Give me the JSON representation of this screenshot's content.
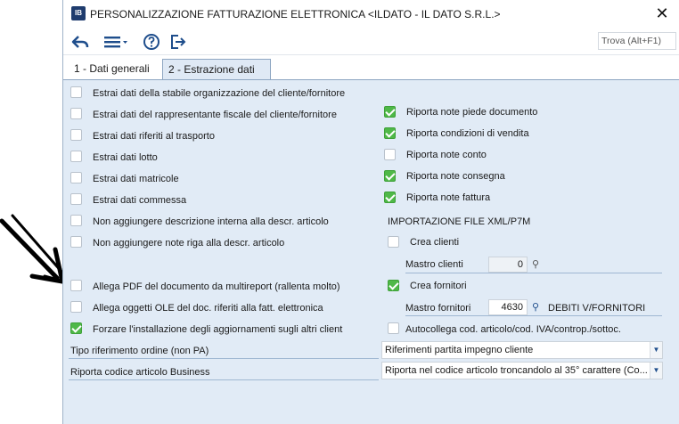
{
  "window": {
    "title": "PERSONALIZZAZIONE FATTURAZIONE ELETTRONICA <ILDATO - IL DATO S.R.L.>",
    "app_icon_text": "IB",
    "close_glyph": "✕"
  },
  "toolbar": {
    "search_placeholder": "Trova (Alt+F1)",
    "icons": [
      "back-arrow-icon",
      "menu-icon",
      "help-icon",
      "exit-icon"
    ]
  },
  "tabs": [
    {
      "label": "1 - Dati generali",
      "active": false
    },
    {
      "label": "2 - Estrazione dati",
      "active": true
    }
  ],
  "left_options": [
    {
      "label": "Estrai dati della stabile organizzazione del cliente/fornitore",
      "checked": false
    },
    {
      "label": "Estrai dati del rappresentante fiscale del cliente/fornitore",
      "checked": false
    },
    {
      "label": "Estrai dati riferiti al trasporto",
      "checked": false
    },
    {
      "label": "Estrai dati lotto",
      "checked": false
    },
    {
      "label": "Estrai dati matricole",
      "checked": false
    },
    {
      "label": "Estrai dati commessa",
      "checked": false
    },
    {
      "label": "Non aggiungere descrizione interna alla descr. articolo",
      "checked": false
    },
    {
      "label": "Non aggiungere note riga alla descr. articolo",
      "checked": false
    },
    {
      "label": "Allega PDF del documento da multireport (rallenta molto)",
      "checked": false
    },
    {
      "label": "Allega oggetti OLE del doc. riferiti alla fatt. elettronica",
      "checked": false
    },
    {
      "label": "Forzare l'installazione degli aggiornamenti sugli altri client",
      "checked": true
    }
  ],
  "right_options": [
    {
      "label": "Riporta note piede documento",
      "checked": true
    },
    {
      "label": "Riporta condizioni di vendita",
      "checked": true
    },
    {
      "label": "Riporta note conto",
      "checked": false
    },
    {
      "label": "Riporta note consegna",
      "checked": true
    },
    {
      "label": "Riporta note fattura",
      "checked": true
    }
  ],
  "import_section": {
    "heading": "IMPORTAZIONE FILE XML/P7M",
    "crea_clienti": {
      "label": "Crea clienti",
      "checked": false
    },
    "mastro_clienti": {
      "label": "Mastro clienti",
      "value": "0",
      "description": ""
    },
    "crea_fornitori": {
      "label": "Crea fornitori",
      "checked": true
    },
    "mastro_fornitori": {
      "label": "Mastro fornitori",
      "value": "4630",
      "description": "DEBITI V/FORNITORI"
    },
    "autocollega": {
      "label": "Autocollega cod. articolo/cod. IVA/controp./sottoc.",
      "checked": false
    }
  },
  "dropdowns": [
    {
      "label": "Tipo riferimento ordine (non PA)",
      "value": "Riferimenti partita impegno cliente"
    },
    {
      "label": "Riporta codice articolo Business",
      "value": "Riporta nel codice articolo troncandolo al 35° carattere (Co..."
    }
  ],
  "colors": {
    "panel_bg": "#e1ebf6",
    "check_green": "#4fb848",
    "toolbar_blue": "#1f4e8c"
  }
}
